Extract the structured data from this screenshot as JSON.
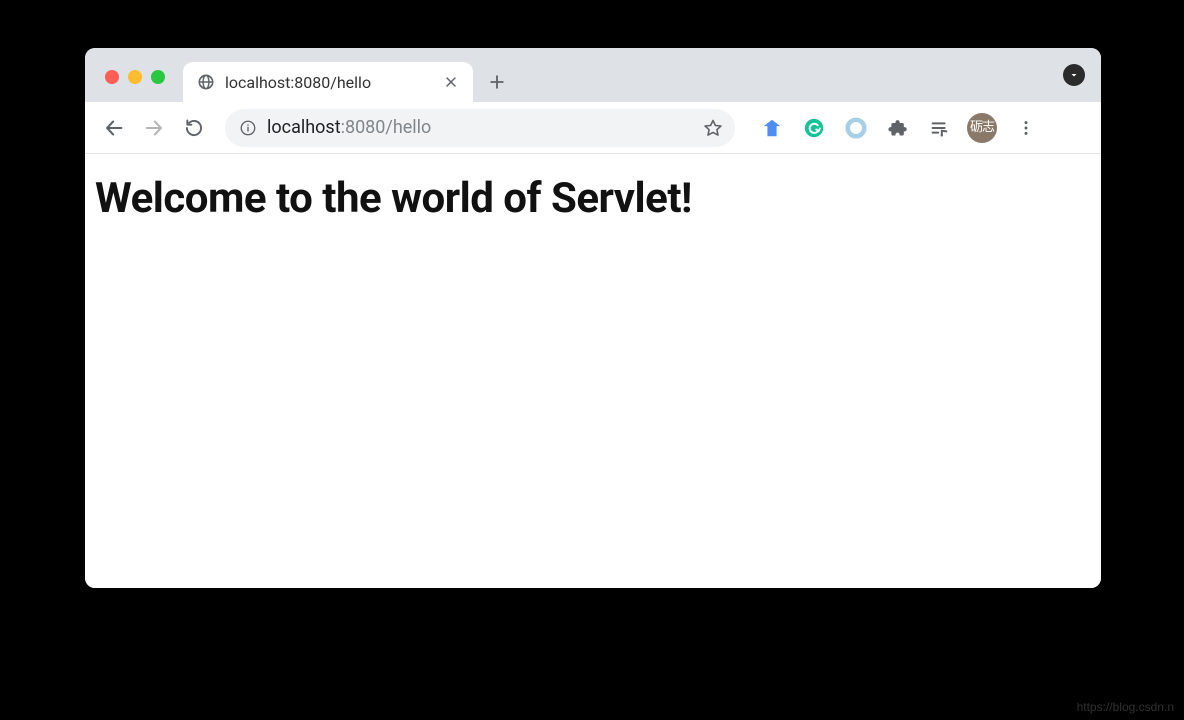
{
  "window": {
    "traffic_lights": {
      "close": "close",
      "min": "minimize",
      "max": "maximize"
    }
  },
  "tab": {
    "title": "localhost:8080/hello"
  },
  "toolbar": {
    "back_label": "Back",
    "forward_label": "Forward",
    "reload_label": "Reload",
    "menu_label": "Menu",
    "extensions_label": "Extensions",
    "star_label": "Bookmark"
  },
  "omnibox": {
    "info_label": "Site information",
    "url_host": "localhost",
    "url_port_path": ":8080/hello",
    "full_url": "localhost:8080/hello"
  },
  "extensions": {
    "capture_color": "#4285f4",
    "grammarly_color": "#15c39a",
    "ring_color": "#9fc7e0",
    "puzzle_color": "#5f6368",
    "music_color": "#5f6368"
  },
  "avatar": {
    "text": "砺志"
  },
  "page": {
    "heading": "Welcome to the world of Servlet!"
  },
  "watermark": {
    "text": "https://blog.csdn.n"
  }
}
